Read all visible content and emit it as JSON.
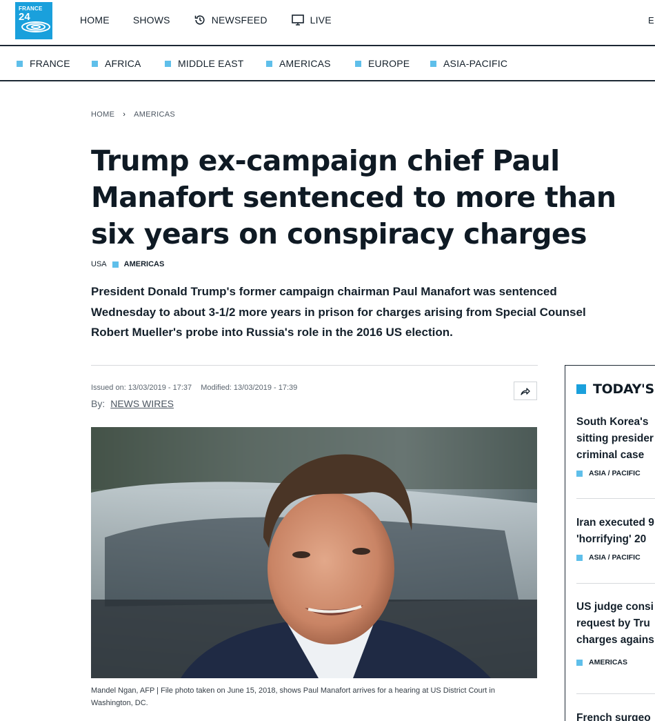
{
  "logo": {
    "line1": "FRANCE",
    "line2": "24"
  },
  "top_nav": [
    {
      "label": "HOME",
      "icon": ""
    },
    {
      "label": "SHOWS",
      "icon": ""
    },
    {
      "label": "NEWSFEED",
      "icon": "history-clock-icon"
    },
    {
      "label": "LIVE",
      "icon": "monitor-icon"
    }
  ],
  "language_label": "E",
  "regions": [
    "FRANCE",
    "AFRICA",
    "MIDDLE EAST",
    "AMERICAS",
    "EUROPE",
    "ASIA-PACIFIC"
  ],
  "breadcrumb": {
    "home": "HOME",
    "separator": "›",
    "section": "AMERICAS"
  },
  "article": {
    "title": "Trump ex-campaign chief Paul Manafort sentenced to more than six years on conspiracy charges",
    "tag_country": "USA",
    "tag_region": "AMERICAS",
    "lede": "President Donald Trump's former campaign chairman Paul Manafort was sentenced Wednesday to about 3-1/2 more years in prison for charges arising from Special Counsel Robert Mueller's probe into Russia's role in the 2016 US election.",
    "issued": "Issued on: 13/03/2019 - 17:37",
    "modified": "Modified: 13/03/2019 - 17:39",
    "by_label": "By:",
    "by_value": "NEWS WIRES",
    "caption": "Mandel Ngan, AFP | File photo taken on June 15, 2018, shows Paul Manafort arrives for a hearing at US District Court in Washington, DC."
  },
  "sidebar": {
    "heading": "TODAY'S",
    "stories": [
      {
        "title_lines": [
          "South Korea's",
          "sitting presider",
          "criminal case"
        ],
        "category": "ASIA / PACIFIC"
      },
      {
        "title_lines": [
          "Iran executed 9",
          "'horrifying' 20"
        ],
        "category": "ASIA / PACIFIC"
      },
      {
        "title_lines": [
          "US judge consi",
          "request by Tru",
          "charges agains"
        ],
        "category": "AMERICAS"
      },
      {
        "title_lines": [
          "French surgeo"
        ],
        "category": ""
      }
    ]
  },
  "colors": {
    "accent": "#1aa0dc",
    "tag_square": "#5fbfea",
    "text": "#14202b"
  }
}
